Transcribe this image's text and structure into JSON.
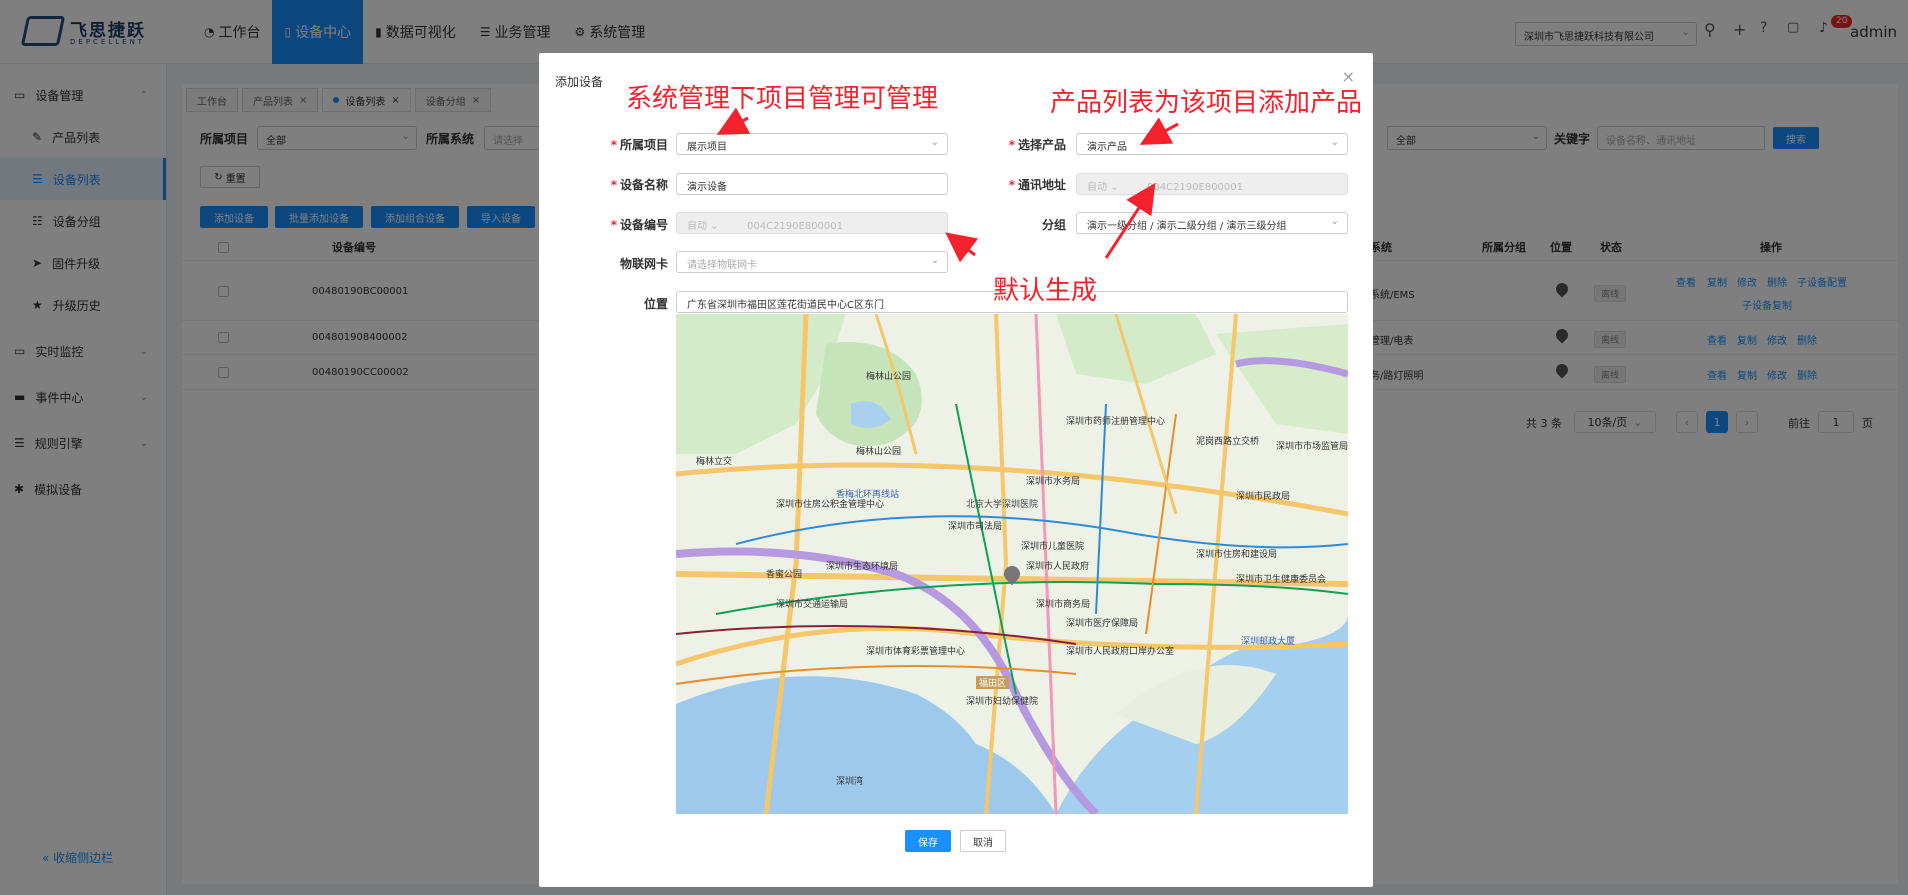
{
  "header": {
    "logo_text": "飞思捷跃",
    "logo_sub": "DEPCELLENT",
    "nav": [
      {
        "icon": "dashboard-icon",
        "label": "工作台"
      },
      {
        "icon": "phone-icon",
        "label": "设备中心"
      },
      {
        "icon": "bar-chart-icon",
        "label": "数据可视化"
      },
      {
        "icon": "list-icon",
        "label": "业务管理"
      },
      {
        "icon": "gear-icon",
        "label": "系统管理"
      }
    ],
    "company": "深圳市飞思捷跃科技有限公司",
    "notification_count": "20",
    "user": "admin"
  },
  "sidebar": {
    "items": [
      {
        "label": "设备管理",
        "level": 0,
        "expandable": true
      },
      {
        "label": "产品列表",
        "level": 1
      },
      {
        "label": "设备列表",
        "level": 1,
        "active": true
      },
      {
        "label": "设备分组",
        "level": 1
      },
      {
        "label": "固件升级",
        "level": 1
      },
      {
        "label": "升级历史",
        "level": 1
      },
      {
        "label": "实时监控",
        "level": 0,
        "expandable": true
      },
      {
        "label": "事件中心",
        "level": 0,
        "expandable": true
      },
      {
        "label": "规则引擎",
        "level": 0,
        "expandable": true
      },
      {
        "label": "模拟设备",
        "level": 0
      }
    ],
    "collapse_label": "收缩侧边栏"
  },
  "tabs": [
    {
      "label": "工作台"
    },
    {
      "label": "产品列表"
    },
    {
      "label": "设备列表",
      "active": true
    },
    {
      "label": "设备分组"
    }
  ],
  "filters": {
    "project_label": "所属项目",
    "project_value": "全部",
    "system_label": "所属系统",
    "system_placeholder": "请选择",
    "other_value": "全部",
    "keyword_label": "关键字",
    "keyword_placeholder": "设备名称、通讯地址",
    "search_label": "搜索",
    "reset_label": "重置"
  },
  "actions": {
    "add": "添加设备",
    "batch_add": "批量添加设备",
    "add_combo": "添加组合设备",
    "import": "导入设备"
  },
  "table": {
    "headers": {
      "code": "设备编号",
      "system": "系统",
      "group": "所属分组",
      "location": "位置",
      "status": "状态",
      "ops": "操作"
    },
    "rows": [
      {
        "code": "00480190BC00001",
        "system": "系统/EMS",
        "status": "离线",
        "ops": [
          "查看",
          "复制",
          "修改",
          "删除",
          "子设备配置",
          "子设备复制"
        ]
      },
      {
        "code": "004801908400002",
        "system": "管理/电表",
        "status": "离线",
        "ops": [
          "查看",
          "复制",
          "修改",
          "删除"
        ]
      },
      {
        "code": "00480190CC00002",
        "system": "务/路灯照明",
        "status": "离线",
        "ops": [
          "查看",
          "复制",
          "修改",
          "删除"
        ]
      }
    ]
  },
  "pagination": {
    "total": "共 3 条",
    "page_size": "10条/页",
    "current_page": "1",
    "goto_label": "前往",
    "goto_value": "1",
    "page_suffix": "页"
  },
  "modal": {
    "title": "添加设备",
    "fields": {
      "project": {
        "label": "所属项目",
        "value": "展示项目"
      },
      "product": {
        "label": "选择产品",
        "value": "演示产品"
      },
      "name": {
        "label": "设备名称",
        "value": "演示设备"
      },
      "address": {
        "label": "通讯地址",
        "mode": "自动",
        "value": "004C2190E800001"
      },
      "code": {
        "label": "设备编号",
        "mode": "自动",
        "value": "004C2190E800001"
      },
      "group": {
        "label": "分组",
        "value": "演示一级分组 / 演示二级分组 / 演示三级分组"
      },
      "sim": {
        "label": "物联网卡",
        "placeholder": "请选择物联网卡"
      },
      "location": {
        "label": "位置",
        "value": "广东省深圳市福田区莲花街道民中心C区东门"
      }
    },
    "save_label": "保存",
    "cancel_label": "取消"
  },
  "map_labels": [
    "梅林山公园",
    "梅林山公园",
    "深圳市药师注册管理中心",
    "深圳市住房公积金管理中心",
    "香梅北环再线站",
    "北京大学深圳医院",
    "深圳市水务局",
    "深圳市司法局",
    "深圳市儿童医院",
    "深圳市生态环境局",
    "深圳市人民政府",
    "深圳市交通运输局",
    "深圳市商务局",
    "深圳市医疗保障局",
    "深圳市体育彩票管理中心",
    "深圳市人民政府口岸办公室",
    "深圳市妇幼保健院",
    "深圳市市场监管局",
    "深圳市民政局",
    "深圳市住房和建设局",
    "深圳市卫生健康委员会",
    "深圳邮政大厦",
    "泥岗西路立交桥",
    "梅林立交",
    "福田区",
    "深圳湾",
    "香蜜公园"
  ],
  "annotations": [
    "系统管理下项目管理可管理",
    "产品列表为该项目添加产品",
    "默认生成"
  ]
}
